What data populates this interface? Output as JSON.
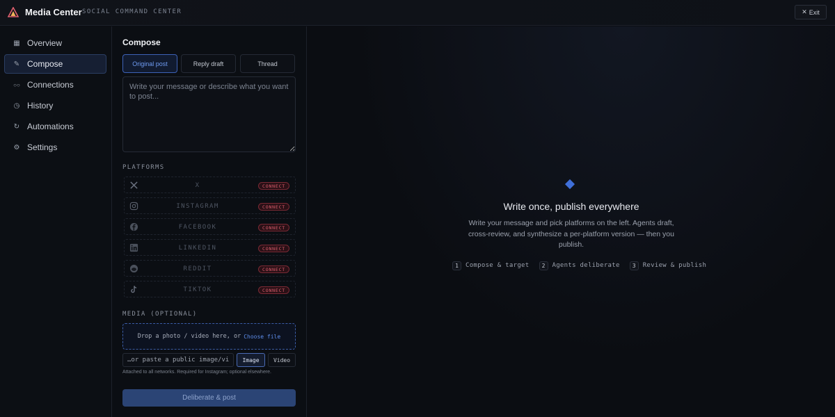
{
  "header": {
    "title": "Media Center",
    "subtitle": "SOCIAL COMMAND CENTER",
    "exit_label": "Exit",
    "exit_icon": "close-icon"
  },
  "sidebar": {
    "items": [
      {
        "label": "Overview",
        "icon": "grid-icon",
        "glyph": "▦",
        "active": false
      },
      {
        "label": "Compose",
        "icon": "quill-icon",
        "glyph": "✎",
        "active": true
      },
      {
        "label": "Connections",
        "icon": "link-icon",
        "glyph": "○○",
        "active": false
      },
      {
        "label": "History",
        "icon": "clock-icon",
        "glyph": "◷",
        "active": false
      },
      {
        "label": "Automations",
        "icon": "refresh-icon",
        "glyph": "↻",
        "active": false
      },
      {
        "label": "Settings",
        "icon": "gear-icon",
        "glyph": "⚙",
        "active": false
      }
    ]
  },
  "compose": {
    "title": "Compose",
    "tabs": [
      {
        "label": "Original post",
        "active": true
      },
      {
        "label": "Reply draft",
        "active": false
      },
      {
        "label": "Thread",
        "active": false
      }
    ],
    "message_value": "",
    "message_placeholder": "Write your message or describe what you want to post...",
    "platforms_label": "PLATFORMS",
    "platforms": [
      {
        "name": "X",
        "icon": "x-icon",
        "action": "CONNECT"
      },
      {
        "name": "INSTAGRAM",
        "icon": "instagram-icon",
        "action": "CONNECT"
      },
      {
        "name": "FACEBOOK",
        "icon": "facebook-icon",
        "action": "CONNECT"
      },
      {
        "name": "LINKEDIN",
        "icon": "linkedin-icon",
        "action": "CONNECT"
      },
      {
        "name": "REDDIT",
        "icon": "reddit-icon",
        "action": "CONNECT"
      },
      {
        "name": "TIKTOK",
        "icon": "tiktok-icon",
        "action": "CONNECT"
      }
    ],
    "media_label": "MEDIA (OPTIONAL)",
    "dropzone_text": "Drop a photo / video here, or",
    "choose_file_label": "Choose file",
    "url_value": "",
    "url_placeholder": "…or paste a public image/video URL",
    "media_types": [
      {
        "label": "Image",
        "active": true
      },
      {
        "label": "Video",
        "active": false
      }
    ],
    "hint": "Attached to all networks. Required for Instagram; optional elsewhere.",
    "submit_label": "Deliberate & post"
  },
  "main": {
    "heading": "Write once, publish everywhere",
    "description": "Write your message and pick platforms on the left. Agents draft, cross-review, and synthesize a per-platform version — then you publish.",
    "steps": [
      {
        "num": "1",
        "label": "Compose & target"
      },
      {
        "num": "2",
        "label": "Agents deliberate"
      },
      {
        "num": "3",
        "label": "Review & publish"
      }
    ]
  },
  "colors": {
    "background": "#0b0d12",
    "accent": "#3f6fd9",
    "connect_red": "#e0606f",
    "active_nav": "#161f33"
  }
}
